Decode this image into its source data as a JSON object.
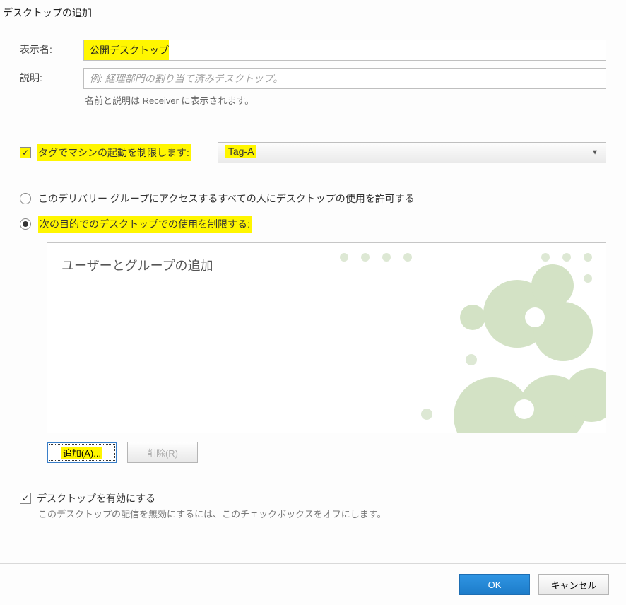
{
  "dialog": {
    "title": "デスクトップの追加"
  },
  "form": {
    "display_name_label": "表示名:",
    "display_name_value": "公開デスクトップ",
    "description_label": "説明:",
    "description_placeholder": "例: 経理部門の割り当て済みデスクトップ。",
    "description_value": "",
    "hint": "名前と説明は Receiver に表示されます。"
  },
  "tag_limit": {
    "checkbox_label": "タグでマシンの起動を制限します:",
    "checked": true,
    "selected_value": "Tag-A"
  },
  "access": {
    "radio_everyone": "このデリバリー グループにアクセスするすべての人にデスクトップの使用を許可する",
    "radio_restrict": "次の目的でのデスクトップでの使用を制限する:",
    "selected": "restrict"
  },
  "users_panel": {
    "title": "ユーザーとグループの追加",
    "add_button": "追加(A)...",
    "remove_button": "削除(R)"
  },
  "enable": {
    "checkbox_label": "デスクトップを有効にする",
    "checked": true,
    "hint": "このデスクトップの配信を無効にするには、このチェックボックスをオフにします。"
  },
  "footer": {
    "ok": "OK",
    "cancel": "キャンセル"
  }
}
